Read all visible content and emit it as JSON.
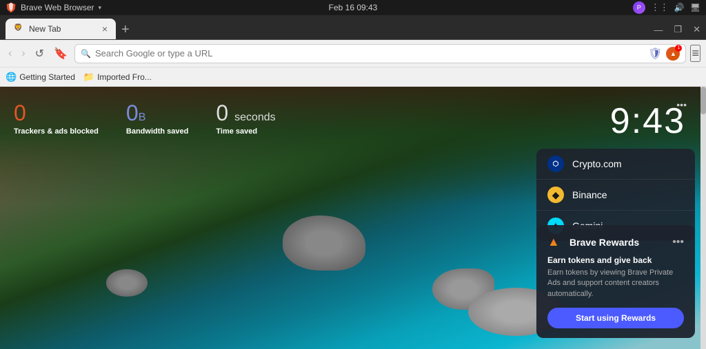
{
  "titlebar": {
    "app_name": "Brave Web Browser",
    "dropdown_arrow": "▾",
    "datetime": "Feb 16  09:43"
  },
  "tabbar": {
    "tab_label": "New Tab",
    "tab_close": "×",
    "tab_new": "+",
    "window_min": "—",
    "window_restore": "❐",
    "window_close": "✕"
  },
  "navbar": {
    "back_label": "‹",
    "forward_label": "›",
    "reload_label": "↺",
    "bookmark_label": "🔖",
    "search_placeholder": "Search Google or type a URL",
    "menu_label": "≡"
  },
  "bookmarks": {
    "item1_label": "Getting Started",
    "item2_label": "Imported Fro..."
  },
  "stats": {
    "trackers_count": "0",
    "trackers_label": "Trackers & ads blocked",
    "bandwidth_count": "0",
    "bandwidth_unit": "B",
    "bandwidth_label": "Bandwidth saved",
    "time_count": "0",
    "time_unit": "seconds",
    "time_label": "Time saved"
  },
  "clock": {
    "time": "9:43",
    "dots_label": "•••"
  },
  "widgets": {
    "items": [
      {
        "id": "crypto",
        "label": "Crypto.com",
        "icon": "⬡"
      },
      {
        "id": "binance",
        "label": "Binance",
        "icon": "◆"
      },
      {
        "id": "gemini",
        "label": "Gemini",
        "icon": "✦"
      }
    ]
  },
  "rewards": {
    "title": "Brave Rewards",
    "more_label": "•••",
    "tagline": "Earn tokens and give back",
    "description": "Earn tokens by viewing Brave Private Ads and support content creators automatically.",
    "button_label": "Start using Rewards"
  }
}
